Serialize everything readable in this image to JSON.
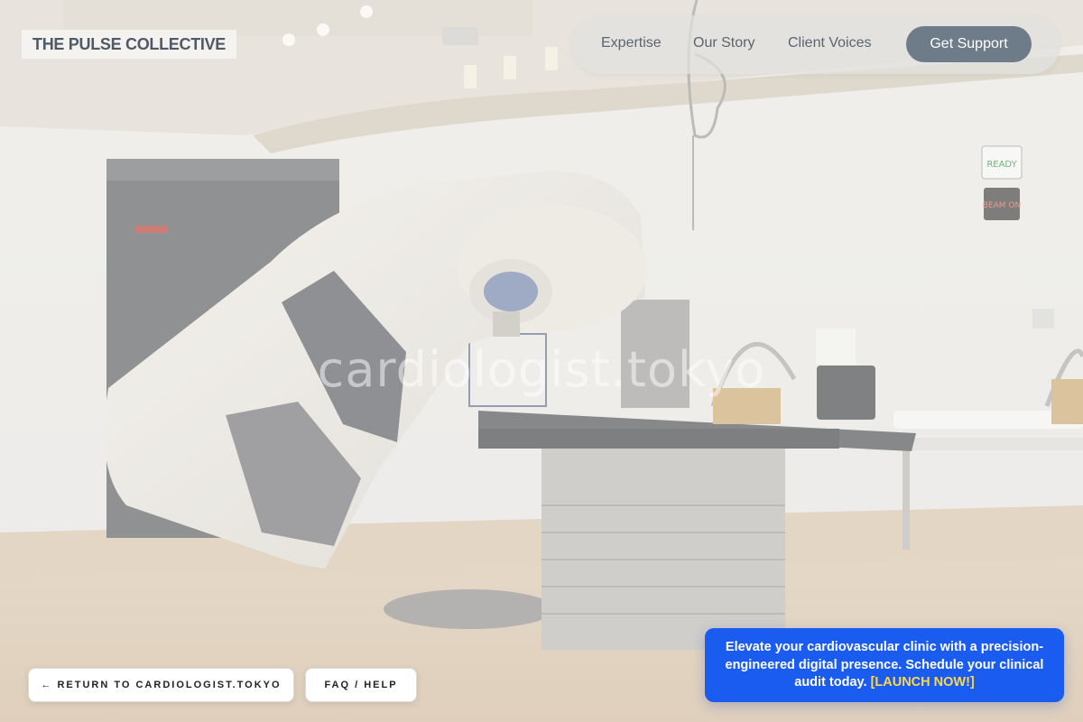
{
  "brand": {
    "name": "THE PULSE COLLECTIVE"
  },
  "nav": {
    "links": [
      "Expertise",
      "Our Story",
      "Client Voices"
    ],
    "cta": "Get Support"
  },
  "hero": {
    "watermark": "cardiologist.tokyo",
    "signs": {
      "ready": "READY",
      "beam_on": "BEAM ON"
    }
  },
  "footer": {
    "return_label": "← RETURN TO CARDIOLOGIST.TOKYO",
    "faq_label": "FAQ / HELP"
  },
  "promo": {
    "text": "Elevate your cardiovascular clinic with a precision-engineered digital presence. Schedule your clinical audit today.",
    "link_label": "[LAUNCH NOW!]"
  },
  "colors": {
    "accent": "#1a5cf0",
    "promo_link": "#ffd84a",
    "nav_cta": "#6e7b89"
  }
}
